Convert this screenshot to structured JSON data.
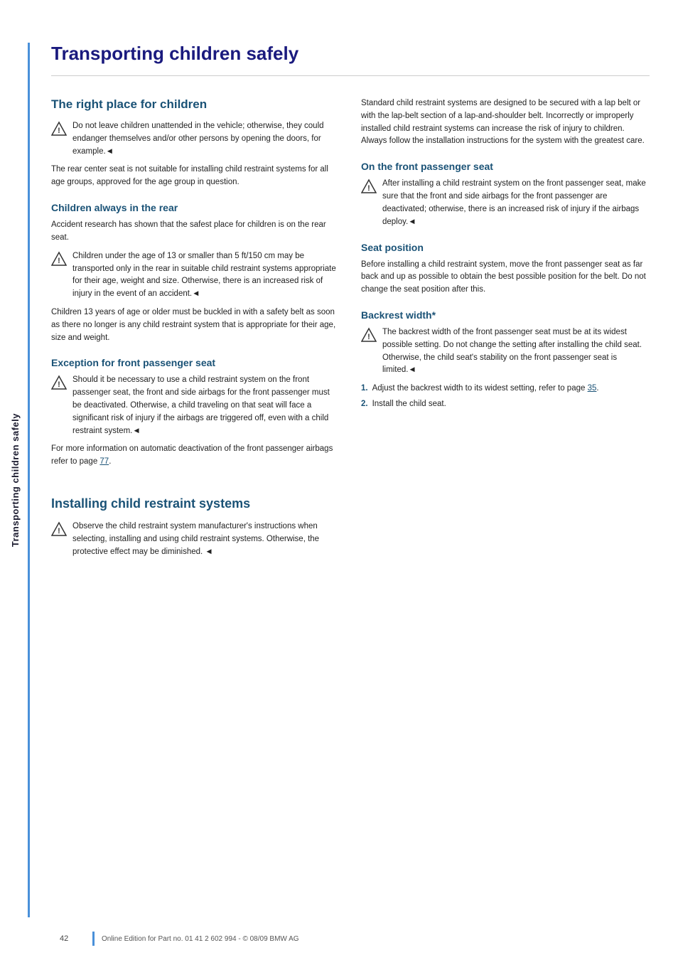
{
  "sidebar": {
    "label": "Transporting children safely"
  },
  "page": {
    "title": "Transporting children safely",
    "footer_page": "42",
    "footer_note": "Online Edition for Part no. 01 41 2 602 994 - © 08/09 BMW AG"
  },
  "left_column": {
    "section1_heading": "The right place for children",
    "warning1_text": "Do not leave children unattended in the vehicle; otherwise, they could endanger themselves and/or other persons by opening the doors, for example.◄",
    "para1": "The rear center seat is not suitable for installing child restraint systems for all age groups, approved for the age group in question.",
    "section2_heading": "Children always in the rear",
    "para2": "Accident research has shown that the safest place for children is on the rear seat.",
    "warning2_text": "Children under the age of 13 or smaller than 5 ft/150 cm may be transported only in the rear in suitable child restraint systems appropriate for their age, weight and size. Otherwise, there is an increased risk of injury in the event of an accident.◄",
    "para3": "Children 13 years of age or older must be buckled in with a safety belt as soon as there no longer is any child restraint system that is appropriate for their age, size and weight.",
    "section3_heading": "Exception for front passenger seat",
    "warning3_text": "Should it be necessary to use a child restraint system on the front passenger seat, the front and side airbags for the front passenger must be deactivated. Otherwise, a child traveling on that seat will face a significant risk of injury if the airbags are triggered off, even with a child restraint system.◄",
    "para4": "For more information on automatic deactivation of the front passenger airbags refer to page 77.",
    "para4_link": "77",
    "installing_heading": "Installing child restraint systems",
    "warning4_text": "Observe the child restraint system manufacturer's instructions when selecting, installing and using child restraint systems. Otherwise, the protective effect may be diminished. ◄"
  },
  "right_column": {
    "para1": "Standard child restraint systems are designed to be secured with a lap belt or with the lap-belt section of a lap-and-shoulder belt. Incorrectly or improperly installed child restraint systems can increase the risk of injury to children. Always follow the installation instructions for the system with the greatest care.",
    "section1_heading": "On the front passenger seat",
    "warning1_text": "After installing a child restraint system on the front passenger seat, make sure that the front and side airbags for the front passenger are deactivated; otherwise, there is an increased risk of injury if the airbags deploy.◄",
    "section2_heading": "Seat position",
    "para2": "Before installing a child restraint system, move the front passenger seat as far back and up as possible to obtain the best possible position for the belt. Do not change the seat position after this.",
    "section3_heading": "Backrest width*",
    "warning2_text": "The backrest width of the front passenger seat must be at its widest possible setting. Do not change the setting after installing the child seat. Otherwise, the child seat's stability on the front passenger seat is limited.◄",
    "list_item1": "Adjust the backrest width to its widest setting, refer to page 35.",
    "list_item1_link": "35",
    "list_item2": "Install the child seat."
  }
}
